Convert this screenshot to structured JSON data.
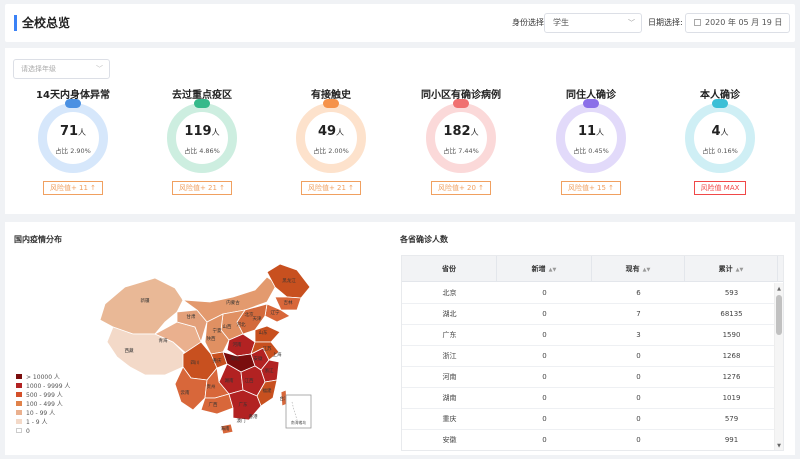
{
  "header": {
    "title": "全校总览",
    "identity_label": "身份选择:",
    "identity_value": "学生",
    "date_label": "日期选择:",
    "date_value": "2020 年 05 月 19 日"
  },
  "filter": {
    "grade_placeholder": "请选择年级"
  },
  "stats": [
    {
      "title": "14天内身体异常",
      "value": "71",
      "unit": "人",
      "pct": "占比 2.90%",
      "risk": "风险值+ 11 ↑",
      "color": "#4a90e2",
      "light": "#d6e7fb",
      "risk_color": "#f0a060"
    },
    {
      "title": "去过重点疫区",
      "value": "119",
      "unit": "人",
      "pct": "占比 4.86%",
      "risk": "风险值+ 21 ↑",
      "color": "#35b98a",
      "light": "#cdeee0",
      "risk_color": "#f0a060"
    },
    {
      "title": "有接触史",
      "value": "49",
      "unit": "人",
      "pct": "占比 2.00%",
      "risk": "风险值+ 21 ↑",
      "color": "#f5924a",
      "light": "#fde2cc",
      "risk_color": "#f0a060"
    },
    {
      "title": "同小区有确诊病例",
      "value": "182",
      "unit": "人",
      "pct": "占比 7.44%",
      "risk": "风险值+ 20 ↑",
      "color": "#f07070",
      "light": "#fbd9d9",
      "risk_color": "#f0a060"
    },
    {
      "title": "同住人确诊",
      "value": "11",
      "unit": "人",
      "pct": "占比 0.45%",
      "risk": "风险值+ 15 ↑",
      "color": "#8b6fe8",
      "light": "#e2dafa",
      "risk_color": "#f0a060"
    },
    {
      "title": "本人确诊",
      "value": "4",
      "unit": "人",
      "pct": "占比 0.16%",
      "risk": "风险值 MAX",
      "color": "#3bbfd6",
      "light": "#cfeff5",
      "risk_color": "#f04848"
    }
  ],
  "map": {
    "title": "国内疫情分布",
    "legend": [
      {
        "label": "> 10000 人",
        "color": "#7a0d0d"
      },
      {
        "label": "1000 - 9999 人",
        "color": "#b22222"
      },
      {
        "label": "500 - 999 人",
        "color": "#d4502a"
      },
      {
        "label": "100 - 499 人",
        "color": "#e0824a"
      },
      {
        "label": "10 - 99 人",
        "color": "#eab08e"
      },
      {
        "label": "1 - 9 人",
        "color": "#f3d9c8"
      },
      {
        "label": "0",
        "color": "#ffffff"
      }
    ],
    "inset_label": "南海诸岛",
    "place_labels": [
      "新疆",
      "西藏",
      "青海",
      "甘肃",
      "内蒙古",
      "黑龙江",
      "吉林",
      "辽宁",
      "北京",
      "天津",
      "河北",
      "山西",
      "陕西",
      "宁夏",
      "河南",
      "山东",
      "四川",
      "重庆",
      "湖北",
      "安徽",
      "江苏",
      "上海",
      "浙江",
      "湖南",
      "江西",
      "福建",
      "贵州",
      "云南",
      "广西",
      "广东",
      "海南",
      "台湾",
      "香港",
      "澳门"
    ]
  },
  "table": {
    "title": "各省确诊人数",
    "headers": [
      "省份",
      "新增",
      "现有",
      "累计"
    ],
    "rows": [
      [
        "北京",
        "0",
        "6",
        "593"
      ],
      [
        "湖北",
        "0",
        "7",
        "68135"
      ],
      [
        "广东",
        "0",
        "3",
        "1590"
      ],
      [
        "浙江",
        "0",
        "0",
        "1268"
      ],
      [
        "河南",
        "0",
        "0",
        "1276"
      ],
      [
        "湖南",
        "0",
        "0",
        "1019"
      ],
      [
        "重庆",
        "0",
        "0",
        "579"
      ],
      [
        "安徽",
        "0",
        "0",
        "991"
      ]
    ]
  }
}
